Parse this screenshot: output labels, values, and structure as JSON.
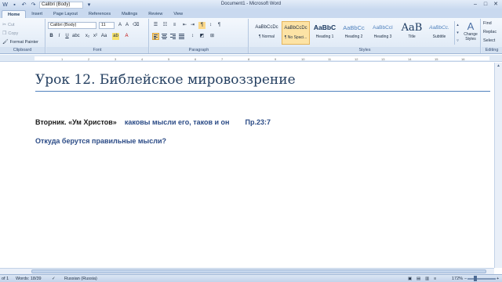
{
  "window": {
    "title": "Document1 - Microsoft Word",
    "qat_font": "Calibri (Body)"
  },
  "tabs": [
    "Home",
    "Insert",
    "Page Layout",
    "References",
    "Mailings",
    "Review",
    "View"
  ],
  "ribbon": {
    "clipboard": {
      "label": "Clipboard",
      "cut": "Cut",
      "copy": "Copy",
      "format_painter": "Format Painter"
    },
    "font": {
      "label": "Font",
      "family": "Calibri (Body)",
      "size": "11"
    },
    "paragraph": {
      "label": "Paragraph"
    },
    "styles": {
      "label": "Styles",
      "items": [
        {
          "sample": "AaBbCcDc",
          "name": "¶ Normal"
        },
        {
          "sample": "AaBbCcDc",
          "name": "¶ No Spaci..."
        },
        {
          "sample": "AaBbC",
          "name": "Heading 1"
        },
        {
          "sample": "AaBbCc",
          "name": "Heading 2"
        },
        {
          "sample": "AaBbCcI",
          "name": "Heading 3"
        },
        {
          "sample": "AaB",
          "name": "Title"
        },
        {
          "sample": "AaBbCc.",
          "name": "Subtitle"
        }
      ],
      "change_styles": "Change Styles"
    },
    "editing": {
      "label": "Editing",
      "find": "Find",
      "replace": "Replac",
      "select": "Select"
    }
  },
  "ruler": {
    "ticks": [
      "1",
      "2",
      "3",
      "4",
      "5",
      "6",
      "7",
      "8",
      "9",
      "10",
      "11",
      "12",
      "13",
      "14",
      "15",
      "16"
    ]
  },
  "document": {
    "heading": "Урок 12. Библейское мировоззрение",
    "line1_black": "Вторник. «Ум Христов»",
    "line1_blue": "каковы мысли его, таков и он",
    "line1_ref": "Пр.23:7",
    "line2": "Откуда берутся правильные  мысли?"
  },
  "statusbar": {
    "page": "of 1",
    "words": "Words: 18/39",
    "language": "Russian (Russia)",
    "zoom": "172%"
  },
  "colors": {
    "heading": "#243f60",
    "accent_blue": "#2b4b86",
    "rule": "#4f81bd",
    "ribbon_bg": "#dde8f5"
  }
}
